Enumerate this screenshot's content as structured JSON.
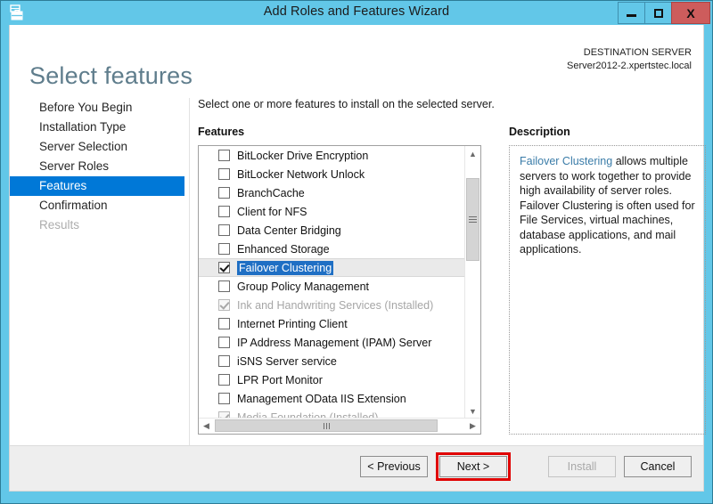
{
  "window": {
    "title": "Add Roles and Features Wizard",
    "icon": "server-wizard-icon",
    "minimize_label": "–",
    "maximize_label": "□",
    "close_label": "X"
  },
  "header": {
    "page_title": "Select features",
    "destination_label": "DESTINATION SERVER",
    "destination_server": "Server2012-2.xpertstec.local"
  },
  "sidebar": {
    "items": [
      {
        "label": "Before You Begin",
        "state": "normal"
      },
      {
        "label": "Installation Type",
        "state": "normal"
      },
      {
        "label": "Server Selection",
        "state": "normal"
      },
      {
        "label": "Server Roles",
        "state": "normal"
      },
      {
        "label": "Features",
        "state": "active"
      },
      {
        "label": "Confirmation",
        "state": "normal"
      },
      {
        "label": "Results",
        "state": "disabled"
      }
    ]
  },
  "main": {
    "instruction": "Select one or more features to install on the selected server.",
    "features_label": "Features",
    "description_label": "Description",
    "features": [
      {
        "label": "BitLocker Drive Encryption",
        "checked": false,
        "installed": false,
        "selected": false
      },
      {
        "label": "BitLocker Network Unlock",
        "checked": false,
        "installed": false,
        "selected": false
      },
      {
        "label": "BranchCache",
        "checked": false,
        "installed": false,
        "selected": false
      },
      {
        "label": "Client for NFS",
        "checked": false,
        "installed": false,
        "selected": false
      },
      {
        "label": "Data Center Bridging",
        "checked": false,
        "installed": false,
        "selected": false
      },
      {
        "label": "Enhanced Storage",
        "checked": false,
        "installed": false,
        "selected": false
      },
      {
        "label": "Failover Clustering",
        "checked": true,
        "installed": false,
        "selected": true
      },
      {
        "label": "Group Policy Management",
        "checked": false,
        "installed": false,
        "selected": false
      },
      {
        "label": "Ink and Handwriting Services (Installed)",
        "checked": true,
        "installed": true,
        "selected": false
      },
      {
        "label": "Internet Printing Client",
        "checked": false,
        "installed": false,
        "selected": false
      },
      {
        "label": "IP Address Management (IPAM) Server",
        "checked": false,
        "installed": false,
        "selected": false
      },
      {
        "label": "iSNS Server service",
        "checked": false,
        "installed": false,
        "selected": false
      },
      {
        "label": "LPR Port Monitor",
        "checked": false,
        "installed": false,
        "selected": false
      },
      {
        "label": "Management OData IIS Extension",
        "checked": false,
        "installed": false,
        "selected": false
      },
      {
        "label": "Media Foundation (Installed)",
        "checked": true,
        "installed": true,
        "selected": false
      }
    ],
    "description": {
      "highlight": "Failover Clustering",
      "body": " allows multiple servers to work together to provide high availability of server roles. Failover Clustering is often used for File Services, virtual machines, database applications, and mail applications."
    }
  },
  "footer": {
    "previous_label": "< Previous",
    "next_label": "Next >",
    "install_label": "Install",
    "cancel_label": "Cancel",
    "install_enabled": false,
    "annotated_button": "Next >"
  },
  "colors": {
    "titlebar": "#62c7e8",
    "close_button": "#cd5c5c",
    "nav_active": "#0078d7",
    "selection_text": "#1f6fc4",
    "page_title": "#5f7d8c",
    "annotation": "#e00000",
    "description_link": "#3a7ca8"
  }
}
